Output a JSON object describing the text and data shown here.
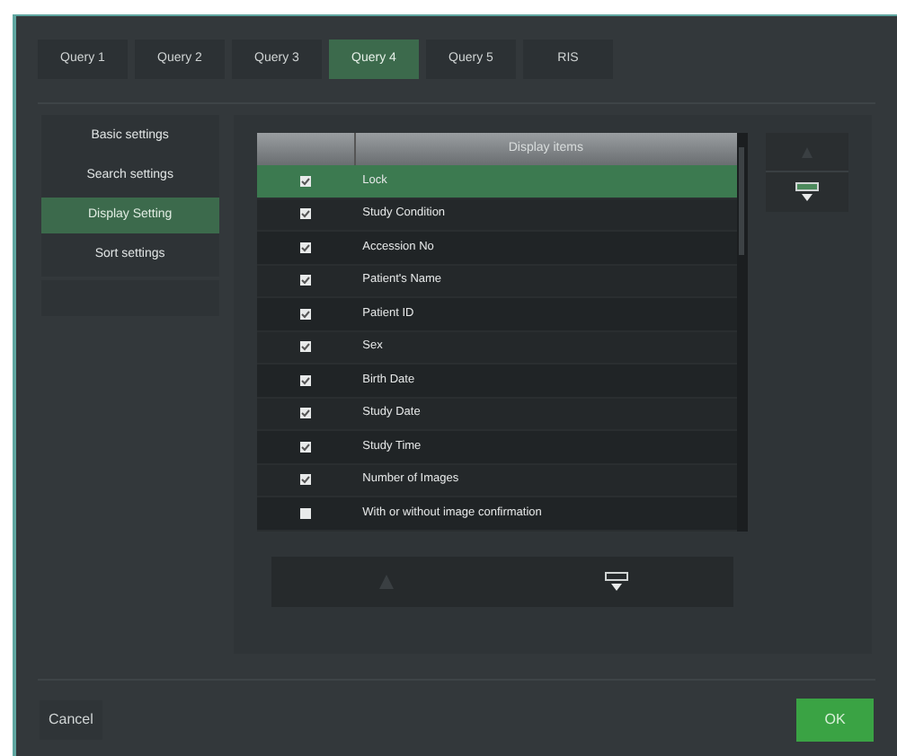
{
  "tabs": [
    {
      "label": "Query 1",
      "selected": false
    },
    {
      "label": "Query 2",
      "selected": false
    },
    {
      "label": "Query 3",
      "selected": false
    },
    {
      "label": "Query 4",
      "selected": true
    },
    {
      "label": "Query 5",
      "selected": false
    },
    {
      "label": "RIS",
      "selected": false
    }
  ],
  "sidebar": {
    "items": [
      {
        "label": "Basic settings",
        "selected": false
      },
      {
        "label": "Search settings",
        "selected": false
      },
      {
        "label": "Display Setting",
        "selected": true
      },
      {
        "label": "Sort settings",
        "selected": false
      }
    ]
  },
  "table": {
    "columns": [
      "Display items"
    ],
    "rows": [
      {
        "label": "Lock",
        "checked": true,
        "selected": true
      },
      {
        "label": "Study Condition",
        "checked": true,
        "selected": false
      },
      {
        "label": "Accession No",
        "checked": true,
        "selected": false
      },
      {
        "label": "Patient's Name",
        "checked": true,
        "selected": false
      },
      {
        "label": "Patient ID",
        "checked": true,
        "selected": false
      },
      {
        "label": "Sex",
        "checked": true,
        "selected": false
      },
      {
        "label": "Birth Date",
        "checked": true,
        "selected": false
      },
      {
        "label": "Study Date",
        "checked": true,
        "selected": false
      },
      {
        "label": "Study Time",
        "checked": true,
        "selected": false
      },
      {
        "label": "Number of Images",
        "checked": true,
        "selected": false
      },
      {
        "label": "With or without image confirmation",
        "checked": false,
        "selected": false
      }
    ]
  },
  "buttons": {
    "cancel": "Cancel",
    "ok": "OK"
  }
}
